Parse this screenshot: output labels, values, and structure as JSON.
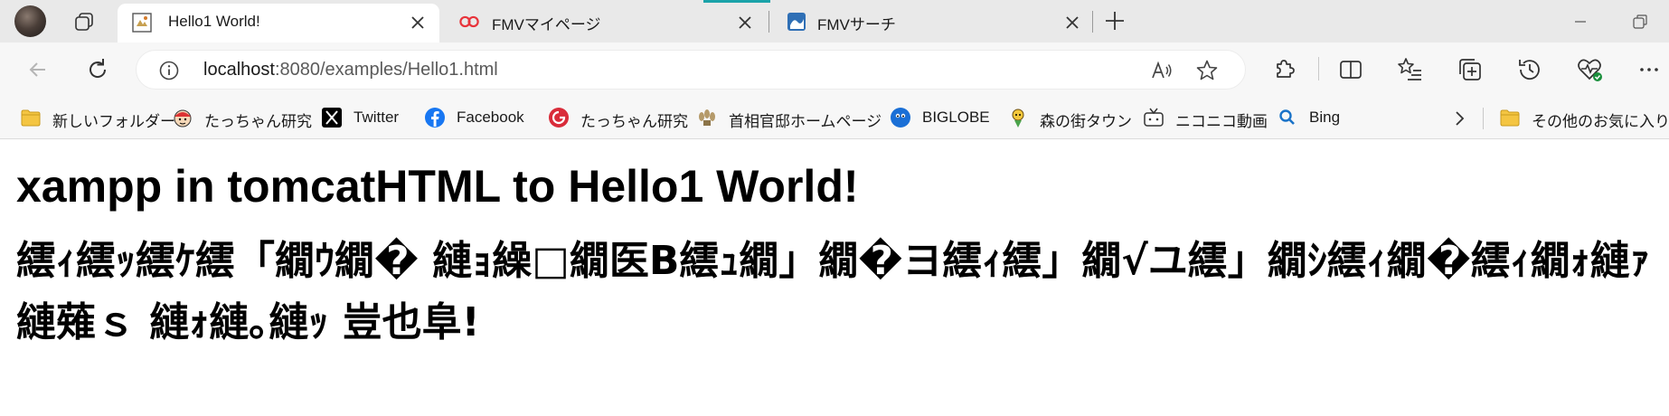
{
  "window": {
    "profile_icon": "profile-avatar",
    "tabs": [
      {
        "title": "Hello1 World!",
        "icon": "page-favicon",
        "active": true
      },
      {
        "title": "FMVマイページ",
        "icon": "fmv-favicon",
        "active": false
      },
      {
        "title": "FMVサーチ",
        "icon": "fmv-search-favicon",
        "active": false
      }
    ]
  },
  "toolbar": {
    "url_host": "localhost",
    "url_rest": ":8080/examples/Hello1.html"
  },
  "favorites": [
    {
      "label": "新しいフォルダー",
      "icon": "folder-icon"
    },
    {
      "label": "たっちゃん研究",
      "icon": "character-icon"
    },
    {
      "label": "Twitter",
      "icon": "x-logo-icon"
    },
    {
      "label": "Facebook",
      "icon": "facebook-icon"
    },
    {
      "label": "たっちゃん研究",
      "icon": "red-swirl-icon"
    },
    {
      "label": "首相官邸ホームページ",
      "icon": "emblem-icon"
    },
    {
      "label": "BIGLOBE",
      "icon": "biglobe-icon"
    },
    {
      "label": "森の街タウン",
      "icon": "mascot-icon"
    },
    {
      "label": "ニコニコ動画",
      "icon": "tv-icon"
    },
    {
      "label": "Bing",
      "icon": "search-icon"
    },
    {
      "label": "その他のお気に入り",
      "icon": "folder-icon"
    }
  ],
  "page": {
    "heading": "xampp in tomcatHTML to Hello1 World!",
    "garbled_text": "繧ｨ繧ｯ繧ｹ繧「繝ｳ繝� 縺ｮ繰□繝医B繧ｭ繝」繝�ヨ繧ｨ繧」繝√ユ繧」繝ｼ繧ｨ繝�繧ｨ繝ｫ縺ｧ 縺薙ｓ 縺ｫ縺｡縺ｯ 豈也阜!"
  },
  "colors": {
    "tabstrip": "#e9e9e9",
    "toolbar": "#f7f7f7",
    "loading_indicator": "#1ba3a9",
    "fmv_red": "#e8333a",
    "facebook_blue": "#1877f2",
    "bing_blue": "#1a73c8",
    "folder_yellow": "#f4c542"
  }
}
